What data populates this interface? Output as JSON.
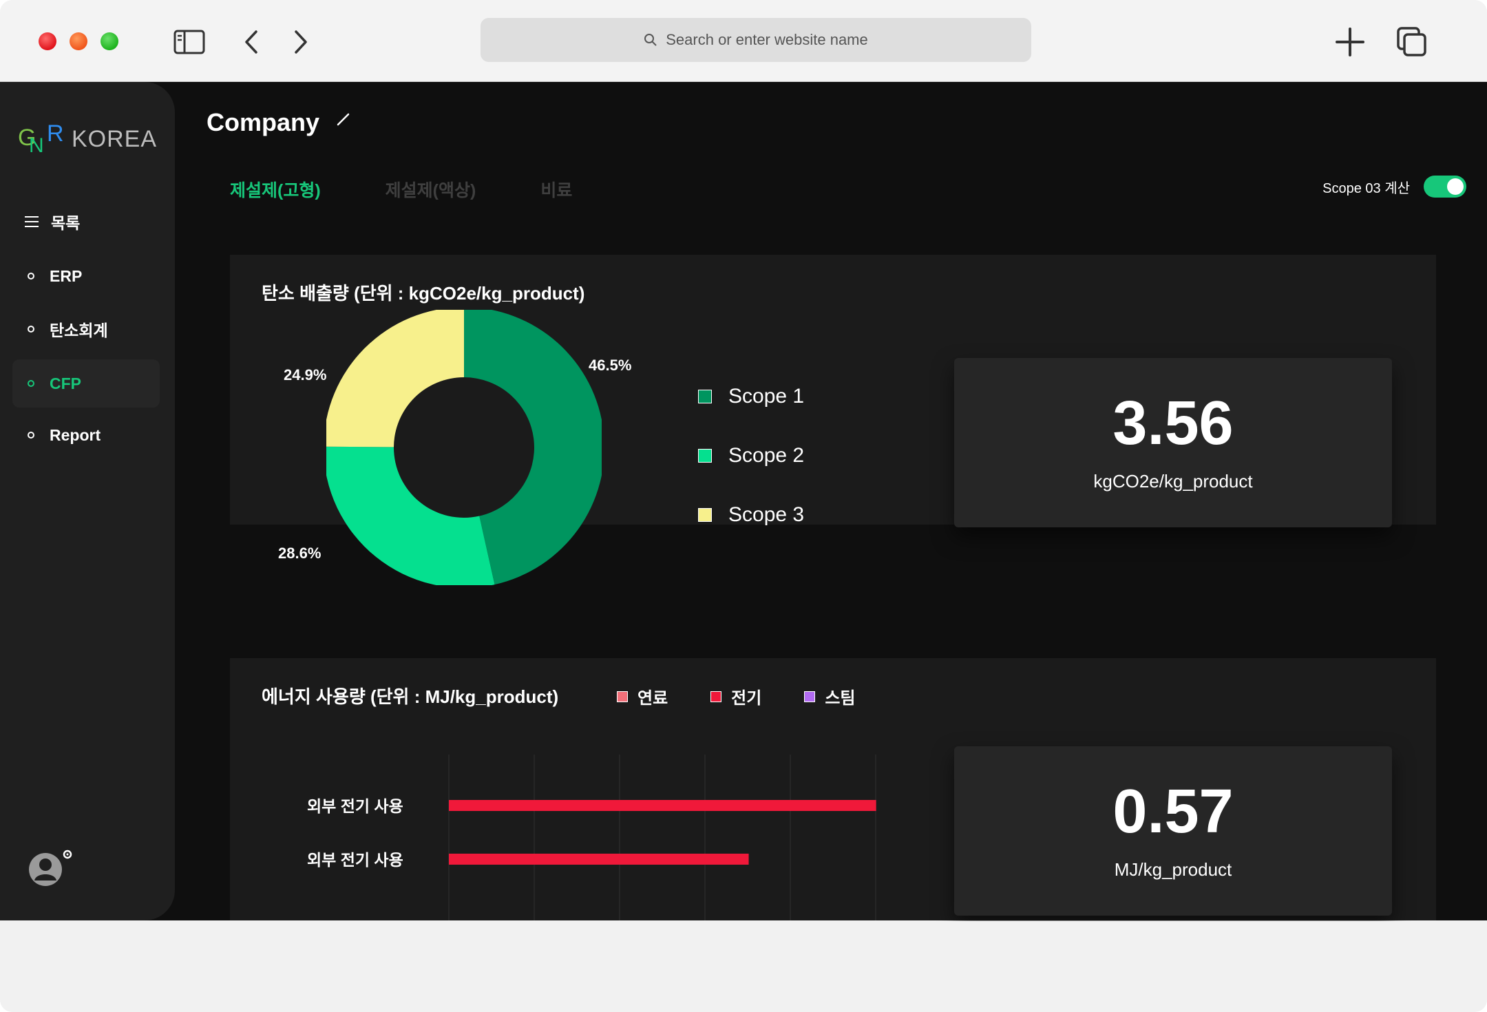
{
  "browser": {
    "url_placeholder": "Search or enter website name"
  },
  "sidebar": {
    "logo_text": "KOREA",
    "menu_label": "목록",
    "items": [
      {
        "label": "ERP",
        "active": false
      },
      {
        "label": "탄소회계",
        "active": false
      },
      {
        "label": "CFP",
        "active": true
      },
      {
        "label": "Report",
        "active": false
      }
    ]
  },
  "header": {
    "title": "Company"
  },
  "tabs": [
    {
      "label": "제설제(고형)",
      "active": true
    },
    {
      "label": "제설제(액상)",
      "active": false
    },
    {
      "label": "비료",
      "active": false
    }
  ],
  "scope_toggle": {
    "label": "Scope 03 계산",
    "on": true
  },
  "emissions": {
    "title": "탄소 배출량 (단위 : kgCO2e/kg_product)",
    "metric_value": "3.56",
    "metric_unit": "kgCO2e/kg_product",
    "slice_labels": {
      "s1": "46.5%",
      "s2": "28.6%",
      "s3": "24.9%"
    }
  },
  "energy": {
    "title": "에너지 사용량 (단위 : MJ/kg_product)",
    "metric_value": "0.57",
    "metric_unit": "MJ/kg_product",
    "legend": [
      {
        "label": "연료",
        "color": "#f2707a"
      },
      {
        "label": "전기",
        "color": "#f0193a"
      },
      {
        "label": "스팀",
        "color": "#b26bf2"
      }
    ],
    "row_labels": [
      "외부 전기 사용",
      "외부 전기 사용"
    ]
  },
  "colors": {
    "accent": "#17c77a",
    "scope1": "#00955f",
    "scope2": "#05e08f",
    "scope3": "#f7f08c",
    "bar": "#f0193a"
  },
  "chart_data": [
    {
      "type": "pie",
      "categories": [
        "Scope 1",
        "Scope 2",
        "Scope 3"
      ],
      "values": [
        46.5,
        28.6,
        24.9
      ],
      "legend": [
        "Scope 1",
        "Scope 2",
        "Scope 3"
      ],
      "colors": [
        "#00955f",
        "#05e08f",
        "#f7f08c"
      ]
    },
    {
      "type": "bar",
      "orientation": "horizontal",
      "categories": [
        "외부 전기 사용",
        "외부 전기 사용"
      ],
      "series": [
        {
          "name": "전기",
          "values": [
            0.57,
            0.4
          ]
        }
      ],
      "xlim": [
        0,
        0.63
      ]
    }
  ]
}
